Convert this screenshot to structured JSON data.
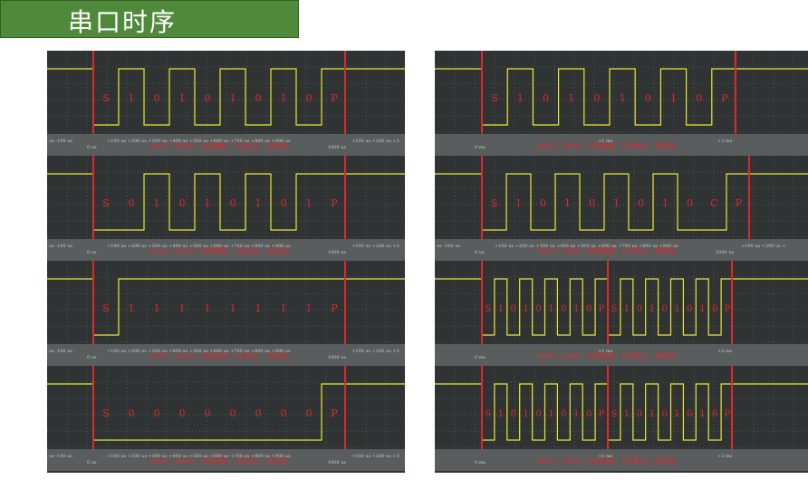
{
  "title": "串口时序",
  "colors": {
    "title_bg": "#4f8a3a",
    "screen": "#303333",
    "trace": "#e8e830",
    "marker": "#e0282c",
    "label": "#e0282c",
    "axis_text": "#c9c9c9"
  },
  "left": {
    "axis_labels": [
      "us -100 us",
      "0 us",
      "+100 us +200 us +300 us +400 us +500 us +600 us +700 us +800 us +900 us",
      "1000 us",
      "+100 us +200 us +3"
    ],
    "scopes": [
      {
        "bits": [
          "S",
          "1",
          "0",
          "1",
          "0",
          "1",
          "0",
          "1",
          "0",
          "P"
        ],
        "levels": [
          0,
          1,
          0,
          1,
          0,
          1,
          0,
          1,
          0,
          1
        ],
        "caption": "0x55 , 9600 , 8位数据 , 1位停止 , 无校验"
      },
      {
        "bits": [
          "S",
          "0",
          "1",
          "0",
          "1",
          "0",
          "1",
          "0",
          "1",
          "P"
        ],
        "levels": [
          0,
          0,
          1,
          0,
          1,
          0,
          1,
          0,
          1,
          1
        ],
        "caption": "0xAA , 9600 , 8位数据 , 1位停止 , 无校验"
      },
      {
        "bits": [
          "S",
          "1",
          "1",
          "1",
          "1",
          "1",
          "1",
          "1",
          "1",
          "P"
        ],
        "levels": [
          0,
          1,
          1,
          1,
          1,
          1,
          1,
          1,
          1,
          1
        ],
        "caption": "0xFF , 9600 , 8位数据 , 1位停止 , 无校验"
      },
      {
        "bits": [
          "S",
          "0",
          "0",
          "0",
          "0",
          "0",
          "0",
          "0",
          "0",
          "P"
        ],
        "levels": [
          0,
          0,
          0,
          0,
          0,
          0,
          0,
          0,
          0,
          1
        ],
        "caption": "0x00 , 9600 , 8位数据 , 1位停止 , 无校验"
      }
    ]
  },
  "right": {
    "scopes": [
      {
        "bits": [
          "S",
          "1",
          "0",
          "1",
          "0",
          "1",
          "0",
          "1",
          "0",
          "P"
        ],
        "levels": [
          0,
          1,
          0,
          1,
          0,
          1,
          0,
          1,
          0,
          1
        ],
        "caption": "0x55 , 9600 , 8位数据 , 1位停止 , 无校验",
        "axis_labels": [
          "0 ms",
          "+1 ms",
          "+2 ms"
        ]
      },
      {
        "bits": [
          "S",
          "1",
          "0",
          "1",
          "0",
          "1",
          "0",
          "1",
          "0",
          "C",
          "P"
        ],
        "levels": [
          0,
          1,
          0,
          1,
          0,
          1,
          0,
          1,
          0,
          0,
          1
        ],
        "caption": "0x55 , 9600 , 8位数据 , 1位停止 , 偶校验",
        "axis_labels": [
          "us -100 us",
          "0 us",
          "+100 us +200 us +300 us +400 us +500 us +600 us +700 us +800 us +900 us",
          "1000 us",
          "+100 us +200 us +"
        ]
      },
      {
        "bits": [
          "S",
          "1",
          "0",
          "1",
          "0",
          "1",
          "0",
          "1",
          "0",
          "P",
          "S",
          "1",
          "0",
          "1",
          "0",
          "1",
          "0",
          "1",
          "0",
          "P"
        ],
        "levels": [
          0,
          1,
          0,
          1,
          0,
          1,
          0,
          1,
          0,
          1,
          0,
          1,
          0,
          1,
          0,
          1,
          0,
          1,
          0,
          1
        ],
        "caption": "0x55 , 9600 , 8位数据 , 1位停止 , 无校验",
        "axis_labels": [
          "0 ms",
          "+1 ms",
          "+2 ms"
        ]
      },
      {
        "bits": [
          "S",
          "1",
          "0",
          "1",
          "0",
          "1",
          "0",
          "1",
          "0",
          "P",
          "S",
          "1",
          "0",
          "1",
          "0",
          "1",
          "0",
          "1",
          "0",
          "P"
        ],
        "levels": [
          0,
          1,
          0,
          1,
          0,
          1,
          0,
          1,
          0,
          1,
          0,
          1,
          0,
          1,
          0,
          1,
          0,
          1,
          0,
          1
        ],
        "caption": "0x55 , 9600 , 8位数据 , 1位停止 , 无校验",
        "axis_labels": [
          "0 ms",
          "+1 ms",
          "+2 ms"
        ]
      }
    ]
  }
}
